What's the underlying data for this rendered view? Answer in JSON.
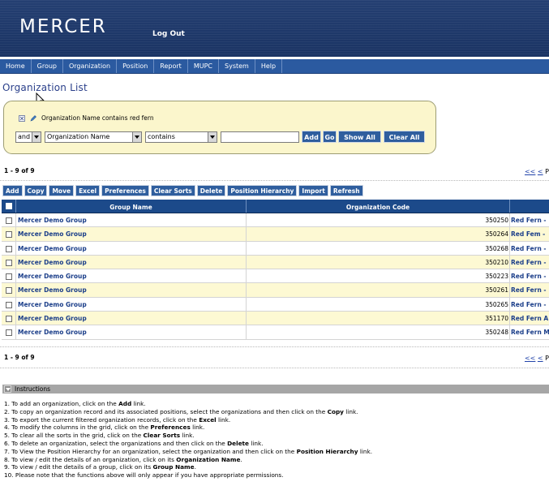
{
  "header": {
    "logo": "MERCER",
    "logout": "Log Out"
  },
  "nav": [
    "Home",
    "Group",
    "Organization",
    "Position",
    "Report",
    "MUPC",
    "System",
    "Help"
  ],
  "page_title": "Organization List",
  "filter": {
    "summary": "Organization Name contains red fern",
    "logic": "and",
    "field": "Organization Name",
    "operator": "contains",
    "value": "",
    "buttons": {
      "add": "Add",
      "go": "Go",
      "show_all": "Show All",
      "clear_all": "Clear All"
    }
  },
  "count_top": "1 - 9 of 9",
  "count_bottom": "1 - 9 of 9",
  "pager": {
    "first": "<<",
    "prev": "<",
    "rest": " P"
  },
  "toolbar": [
    "Add",
    "Copy",
    "Move",
    "Excel",
    "Preferences",
    "Clear Sorts",
    "Delete",
    "Position Hierarchy",
    "Import",
    "Refresh"
  ],
  "grid": {
    "headers": [
      "Group Name",
      "Organization Code",
      ""
    ],
    "rows": [
      [
        "Mercer Demo Group",
        "350250",
        "Red Fern -"
      ],
      [
        "Mercer Demo Group",
        "350264",
        "Red Fem -"
      ],
      [
        "Mercer Demo Group",
        "350268",
        "Red Fern -"
      ],
      [
        "Mercer Demo Group",
        "350210",
        "Red Fern -"
      ],
      [
        "Mercer Demo Group",
        "350223",
        "Red Fern -"
      ],
      [
        "Mercer Demo Group",
        "350261",
        "Red Fern -"
      ],
      [
        "Mercer Demo Group",
        "350265",
        "Red Fern -"
      ],
      [
        "Mercer Demo Group",
        "351170",
        "Red Fern A"
      ],
      [
        "Mercer Demo Group",
        "350248",
        "Red Fern M"
      ]
    ]
  },
  "instructions": {
    "title": "Instructions",
    "items": [
      [
        "1. To add an organization, click on the ",
        "Add",
        " link."
      ],
      [
        "2. To copy an organization record and its associated positions, select the organizations and then click on the ",
        "Copy",
        " link."
      ],
      [
        "3. To export the current filtered organization records, click on the ",
        "Excel",
        " link."
      ],
      [
        "4. To modify the columns in the grid, click on the ",
        "Preferences",
        " link."
      ],
      [
        "5. To clear all the sorts in the grid, click on the ",
        "Clear Sorts",
        " link."
      ],
      [
        "6. To delete an organization, select the organizations and then click on the ",
        "Delete",
        " link."
      ],
      [
        "7. To View the Position Hierarchy for an organization, select the organization and then click on the ",
        "Position Hierarchy",
        " link."
      ],
      [
        "8. To view / edit the details of an organization, click on its ",
        "Organization Name",
        "."
      ],
      [
        "9. To view / edit the details of a group, click on its ",
        "Group Name",
        "."
      ],
      [
        "10. Please note that the functions above will only appear if you have appropriate permissions.",
        "",
        ""
      ]
    ]
  }
}
